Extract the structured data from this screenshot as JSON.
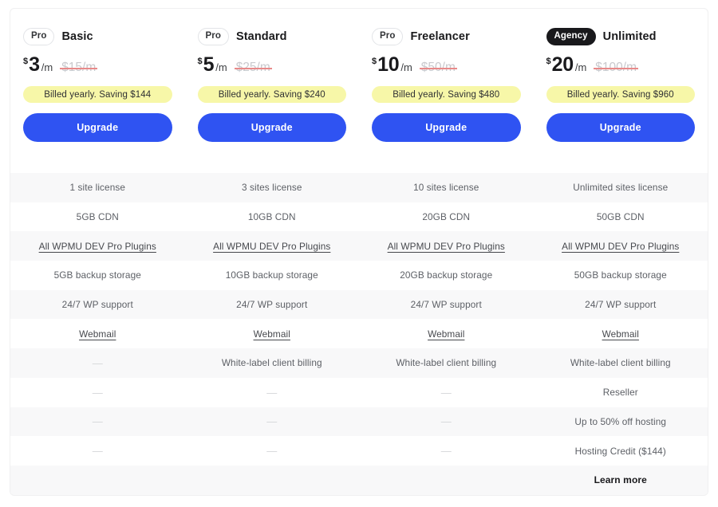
{
  "colors": {
    "accent_button": "#2f53f2",
    "saving_banner": "#f7f7a8",
    "agency_badge": "#19191c",
    "row_shade": "#f8f8f9",
    "strikethrough": "#e88a8a"
  },
  "plans": [
    {
      "badge": "Pro",
      "badge_type": "pro",
      "name": "Basic",
      "currency": "$",
      "amount": "3",
      "per": "/m",
      "old_price": "$15/m",
      "saving": "Billed yearly. Saving  $144",
      "cta": "Upgrade"
    },
    {
      "badge": "Pro",
      "badge_type": "pro",
      "name": "Standard",
      "currency": "$",
      "amount": "5",
      "per": "/m",
      "old_price": "$25/m",
      "saving": "Billed yearly. Saving  $240",
      "cta": "Upgrade"
    },
    {
      "badge": "Pro",
      "badge_type": "pro",
      "name": "Freelancer",
      "currency": "$",
      "amount": "10",
      "per": "/m",
      "old_price": "$50/m",
      "saving": "Billed yearly. Saving  $480",
      "cta": "Upgrade"
    },
    {
      "badge": "Agency",
      "badge_type": "agency",
      "name": "Unlimited",
      "currency": "$",
      "amount": "20",
      "per": "/m",
      "old_price": "$100/m",
      "saving": "Billed yearly. Saving  $960",
      "cta": "Upgrade"
    }
  ],
  "feature_rows": [
    {
      "shaded": true,
      "cells": [
        {
          "text": "1 site license",
          "style": "plain"
        },
        {
          "text": "3 sites license",
          "style": "plain"
        },
        {
          "text": "10 sites license",
          "style": "plain"
        },
        {
          "text": "Unlimited sites license",
          "style": "plain"
        }
      ]
    },
    {
      "shaded": false,
      "cells": [
        {
          "text": "5GB CDN",
          "style": "plain"
        },
        {
          "text": "10GB CDN",
          "style": "plain"
        },
        {
          "text": "20GB CDN",
          "style": "plain"
        },
        {
          "text": "50GB CDN",
          "style": "plain"
        }
      ]
    },
    {
      "shaded": true,
      "cells": [
        {
          "text": "All WPMU DEV Pro Plugins",
          "style": "link"
        },
        {
          "text": "All WPMU DEV Pro Plugins",
          "style": "link"
        },
        {
          "text": "All WPMU DEV Pro Plugins",
          "style": "link"
        },
        {
          "text": "All WPMU DEV Pro Plugins",
          "style": "link"
        }
      ]
    },
    {
      "shaded": false,
      "cells": [
        {
          "text": "5GB backup storage",
          "style": "plain"
        },
        {
          "text": "10GB backup storage",
          "style": "plain"
        },
        {
          "text": "20GB backup storage",
          "style": "plain"
        },
        {
          "text": "50GB backup storage",
          "style": "plain"
        }
      ]
    },
    {
      "shaded": true,
      "cells": [
        {
          "text": "24/7 WP support",
          "style": "plain"
        },
        {
          "text": "24/7 WP support",
          "style": "plain"
        },
        {
          "text": "24/7 WP support",
          "style": "plain"
        },
        {
          "text": "24/7 WP support",
          "style": "plain"
        }
      ]
    },
    {
      "shaded": false,
      "cells": [
        {
          "text": "Webmail",
          "style": "link"
        },
        {
          "text": "Webmail",
          "style": "link"
        },
        {
          "text": "Webmail",
          "style": "link"
        },
        {
          "text": "Webmail",
          "style": "link"
        }
      ]
    },
    {
      "shaded": true,
      "cells": [
        {
          "text": "—",
          "style": "empty"
        },
        {
          "text": "White-label client billing",
          "style": "plain"
        },
        {
          "text": "White-label client billing",
          "style": "plain"
        },
        {
          "text": "White-label client billing",
          "style": "plain"
        }
      ]
    },
    {
      "shaded": false,
      "cells": [
        {
          "text": "—",
          "style": "empty"
        },
        {
          "text": "—",
          "style": "empty"
        },
        {
          "text": "—",
          "style": "empty"
        },
        {
          "text": "Reseller",
          "style": "plain"
        }
      ]
    },
    {
      "shaded": true,
      "cells": [
        {
          "text": "—",
          "style": "empty"
        },
        {
          "text": "—",
          "style": "empty"
        },
        {
          "text": "—",
          "style": "empty"
        },
        {
          "text": "Up to 50% off hosting",
          "style": "plain"
        }
      ]
    },
    {
      "shaded": false,
      "cells": [
        {
          "text": "—",
          "style": "empty"
        },
        {
          "text": "—",
          "style": "empty"
        },
        {
          "text": "—",
          "style": "empty"
        },
        {
          "text": "Hosting Credit ($144)",
          "style": "plain"
        }
      ]
    },
    {
      "shaded": true,
      "cells": [
        {
          "text": "",
          "style": "plain"
        },
        {
          "text": "",
          "style": "plain"
        },
        {
          "text": "",
          "style": "plain"
        },
        {
          "text": "Learn more",
          "style": "learn-more"
        }
      ]
    }
  ]
}
